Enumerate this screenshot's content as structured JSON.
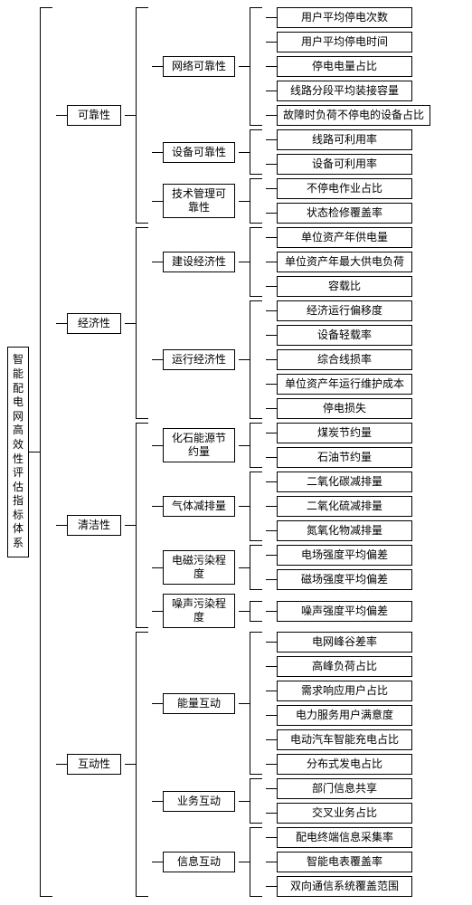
{
  "root": "智能配电网高效性评估指标体系",
  "l1": {
    "a": "可靠性",
    "b": "经济性",
    "c": "清洁性",
    "d": "互动性"
  },
  "l2": {
    "a1": "网络可靠性",
    "a2": "设备可靠性",
    "a3": "技术管理可靠性",
    "b1": "建设经济性",
    "b2": "运行经济性",
    "c1": "化石能源节约量",
    "c2": "气体减排量",
    "c3": "电磁污染程度",
    "c4": "噪声污染程度",
    "d1": "能量互动",
    "d2": "业务互动",
    "d3": "信息互动"
  },
  "leaf": {
    "a1_1": "用户平均停电次数",
    "a1_2": "用户平均停电时间",
    "a1_3": "停电电量占比",
    "a1_4": "线路分段平均装接容量",
    "a1_5": "故障时负荷不停电的设备占比",
    "a2_1": "线路可利用率",
    "a2_2": "设备可利用率",
    "a3_1": "不停电作业占比",
    "a3_2": "状态检修覆盖率",
    "b1_1": "单位资产年供电量",
    "b1_2": "单位资产年最大供电负荷",
    "b1_3": "容载比",
    "b2_1": "经济运行偏移度",
    "b2_2": "设备轻载率",
    "b2_3": "综合线损率",
    "b2_4": "单位资产年运行维护成本",
    "b2_5": "停电损失",
    "c1_1": "煤炭节约量",
    "c1_2": "石油节约量",
    "c2_1": "二氧化碳减排量",
    "c2_2": "二氧化硫减排量",
    "c2_3": "氮氧化物减排量",
    "c3_1": "电场强度平均偏差",
    "c3_2": "磁场强度平均偏差",
    "c4_1": "噪声强度平均偏差",
    "d1_1": "电网峰谷差率",
    "d1_2": "高峰负荷占比",
    "d1_3": "需求响应用户占比",
    "d1_4": "电力服务用户满意度",
    "d1_5": "电动汽车智能充电占比",
    "d1_6": "分布式发电占比",
    "d2_1": "部门信息共享",
    "d2_2": "交叉业务占比",
    "d3_1": "配电终端信息采集率",
    "d3_2": "智能电表覆盖率",
    "d3_3": "双向通信系统覆盖范围"
  }
}
